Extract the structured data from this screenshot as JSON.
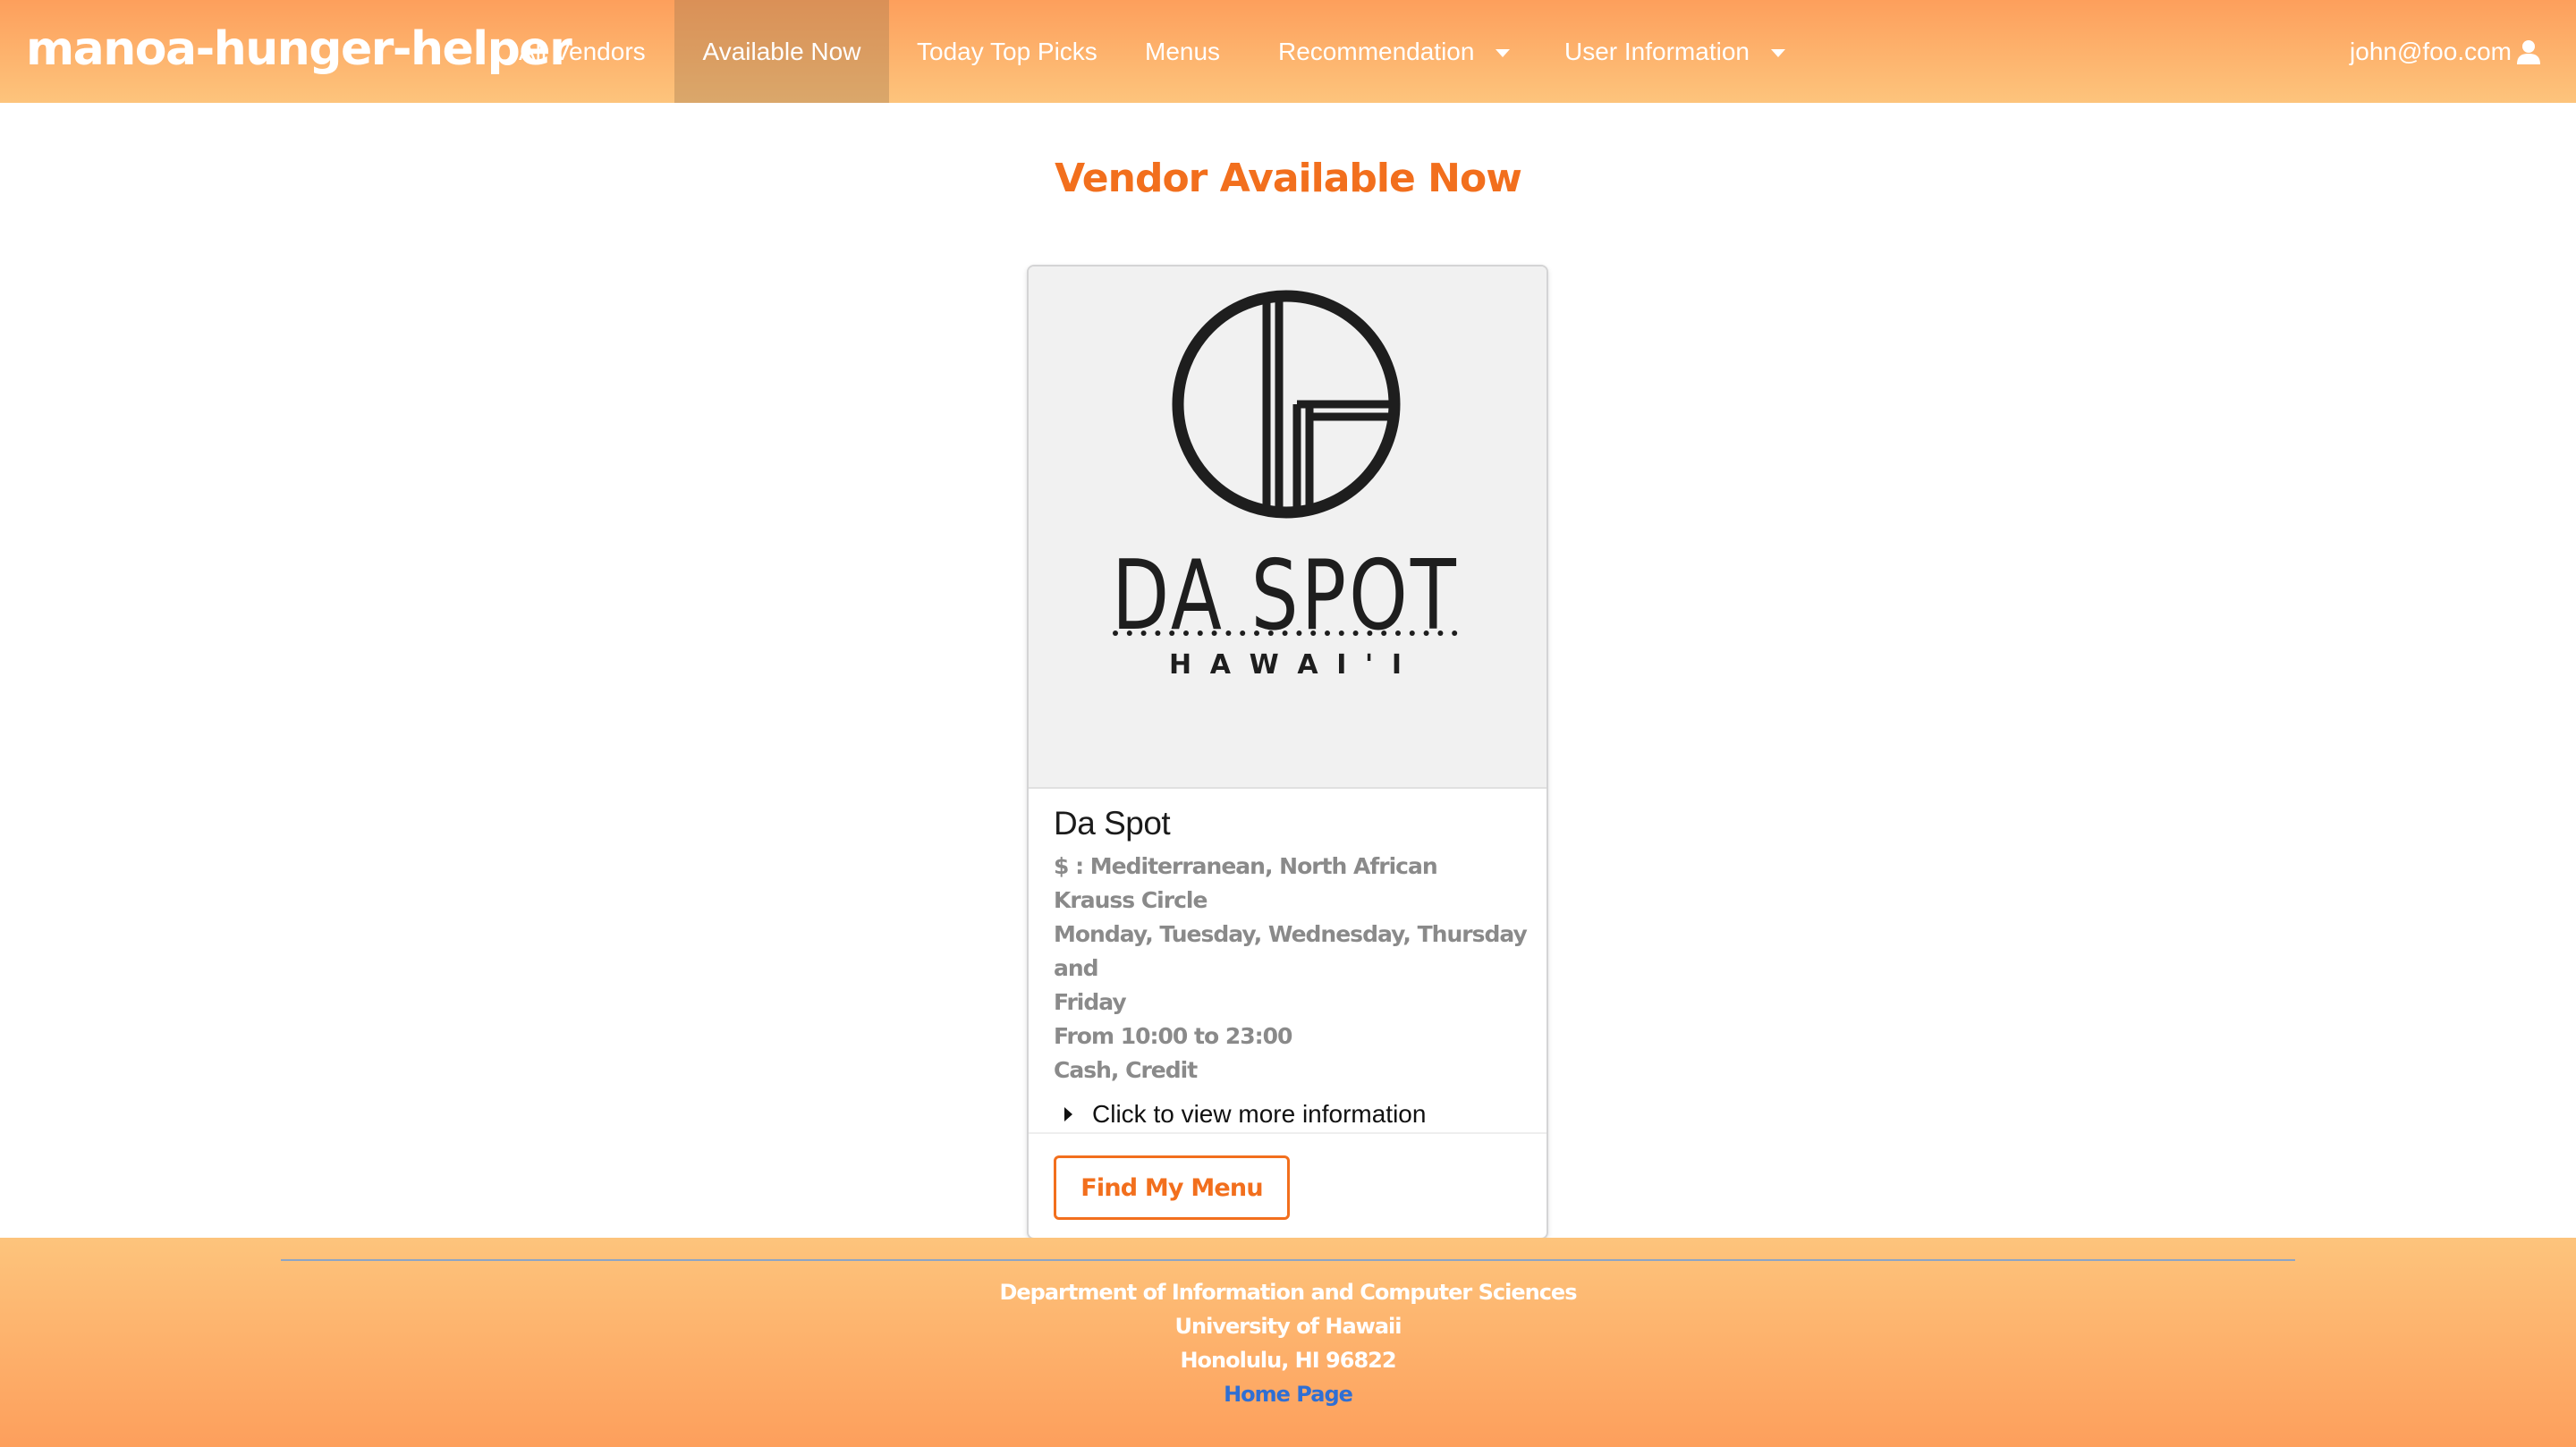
{
  "navbar": {
    "brand": "manoa-hunger-helper",
    "items": [
      {
        "label": "All Vendors",
        "active": false
      },
      {
        "label": "Available Now",
        "active": true
      },
      {
        "label": "Today Top Picks",
        "active": false
      },
      {
        "label": "Menus",
        "active": false
      },
      {
        "label": "Recommendation",
        "active": false,
        "dropdown": true
      },
      {
        "label": "User Information",
        "active": false,
        "dropdown": true
      }
    ],
    "user": {
      "email": "john@foo.com",
      "icon": "user-icon"
    }
  },
  "main": {
    "title": "Vendor Available Now",
    "card": {
      "logo": {
        "name": "DA SPOT",
        "sub": "H A W A I ' I"
      },
      "name": "Da Spot",
      "cuisine": "$ : Mediterranean, North African",
      "location": "Krauss Circle",
      "days_line1": "Monday, Tuesday, Wednesday, Thursday and",
      "days_line2": "Friday",
      "hours": "From 10:00 to 23:00",
      "payment": "Cash, Credit",
      "expander_label": "Click to view more information",
      "button_label": "Find My Menu"
    }
  },
  "footer": {
    "line1": "Department of Information and Computer Sciences",
    "line2": "University of Hawaii",
    "line3": "Honolulu, HI 96822",
    "link": "Home Page"
  },
  "colors": {
    "accent": "#f26f1d",
    "nav_gradient_top": "#fd9f5c",
    "nav_gradient_bottom": "#fdc47c",
    "link": "#2f6fd4"
  }
}
